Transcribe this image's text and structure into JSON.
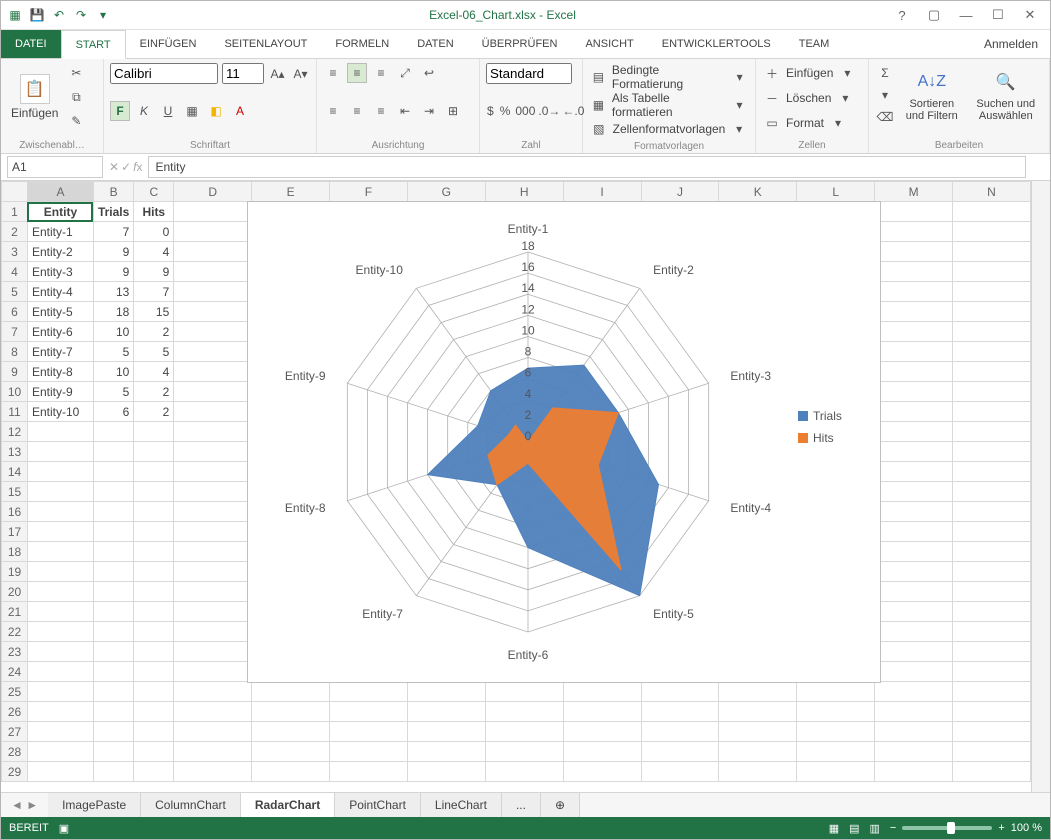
{
  "app": {
    "title": "Excel-06_Chart.xlsx - Excel",
    "signin": "Anmelden"
  },
  "qat": {
    "save": "💾",
    "undo": "↶",
    "redo": "↷"
  },
  "tabs": {
    "file": "DATEI",
    "start": "START",
    "insert": "EINFÜGEN",
    "layout": "SEITENLAYOUT",
    "formulas": "FORMELN",
    "data": "DATEN",
    "review": "ÜBERPRÜFEN",
    "view": "ANSICHT",
    "dev": "ENTWICKLERTOOLS",
    "team": "TEAM"
  },
  "ribbon": {
    "clipboard": {
      "label": "Zwischenabl…",
      "paste": "Einfügen"
    },
    "font": {
      "label": "Schriftart",
      "name": "Calibri",
      "size": "11"
    },
    "align": {
      "label": "Ausrichtung"
    },
    "number": {
      "label": "Zahl",
      "preset": "Standard"
    },
    "styles": {
      "label": "Formatvorlagen",
      "cond": "Bedingte Formatierung",
      "table": "Als Tabelle formatieren",
      "cell": "Zellenformatvorlagen"
    },
    "cells": {
      "label": "Zellen",
      "insert": "Einfügen",
      "delete": "Löschen",
      "format": "Format"
    },
    "editing": {
      "label": "Bearbeiten",
      "sort": "Sortieren und Filtern",
      "find": "Suchen und Auswählen"
    }
  },
  "fbar": {
    "name": "A1",
    "formula": "Entity"
  },
  "headers": [
    "A",
    "B",
    "C",
    "D",
    "E",
    "F",
    "G",
    "H",
    "I",
    "J",
    "K",
    "L",
    "M",
    "N"
  ],
  "table": {
    "cols": [
      "Entity",
      "Trials",
      "Hits"
    ],
    "rows": [
      [
        "Entity-1",
        7,
        0
      ],
      [
        "Entity-2",
        9,
        4
      ],
      [
        "Entity-3",
        9,
        9
      ],
      [
        "Entity-4",
        13,
        7
      ],
      [
        "Entity-5",
        18,
        15
      ],
      [
        "Entity-6",
        10,
        2
      ],
      [
        "Entity-7",
        5,
        5
      ],
      [
        "Entity-8",
        10,
        4
      ],
      [
        "Entity-9",
        5,
        2
      ],
      [
        "Entity-10",
        6,
        2
      ]
    ]
  },
  "chart_data": {
    "type": "radar",
    "categories": [
      "Entity-1",
      "Entity-2",
      "Entity-3",
      "Entity-4",
      "Entity-5",
      "Entity-6",
      "Entity-7",
      "Entity-8",
      "Entity-9",
      "Entity-10"
    ],
    "series": [
      {
        "name": "Trials",
        "color": "#4f81bd",
        "values": [
          7,
          9,
          9,
          13,
          18,
          10,
          5,
          10,
          5,
          6
        ]
      },
      {
        "name": "Hits",
        "color": "#ed7d31",
        "values": [
          0,
          4,
          9,
          7,
          15,
          2,
          5,
          4,
          2,
          2
        ]
      }
    ],
    "ticks": [
      0,
      2,
      4,
      6,
      8,
      10,
      12,
      14,
      16,
      18
    ],
    "max": 18
  },
  "sheets": {
    "list": [
      "ImagePaste",
      "ColumnChart",
      "RadarChart",
      "PointChart",
      "LineChart"
    ],
    "more": "...",
    "add": "⊕",
    "active": "RadarChart",
    "nav": "◄  ►"
  },
  "status": {
    "ready": "BEREIT",
    "zoom": "100 %"
  }
}
